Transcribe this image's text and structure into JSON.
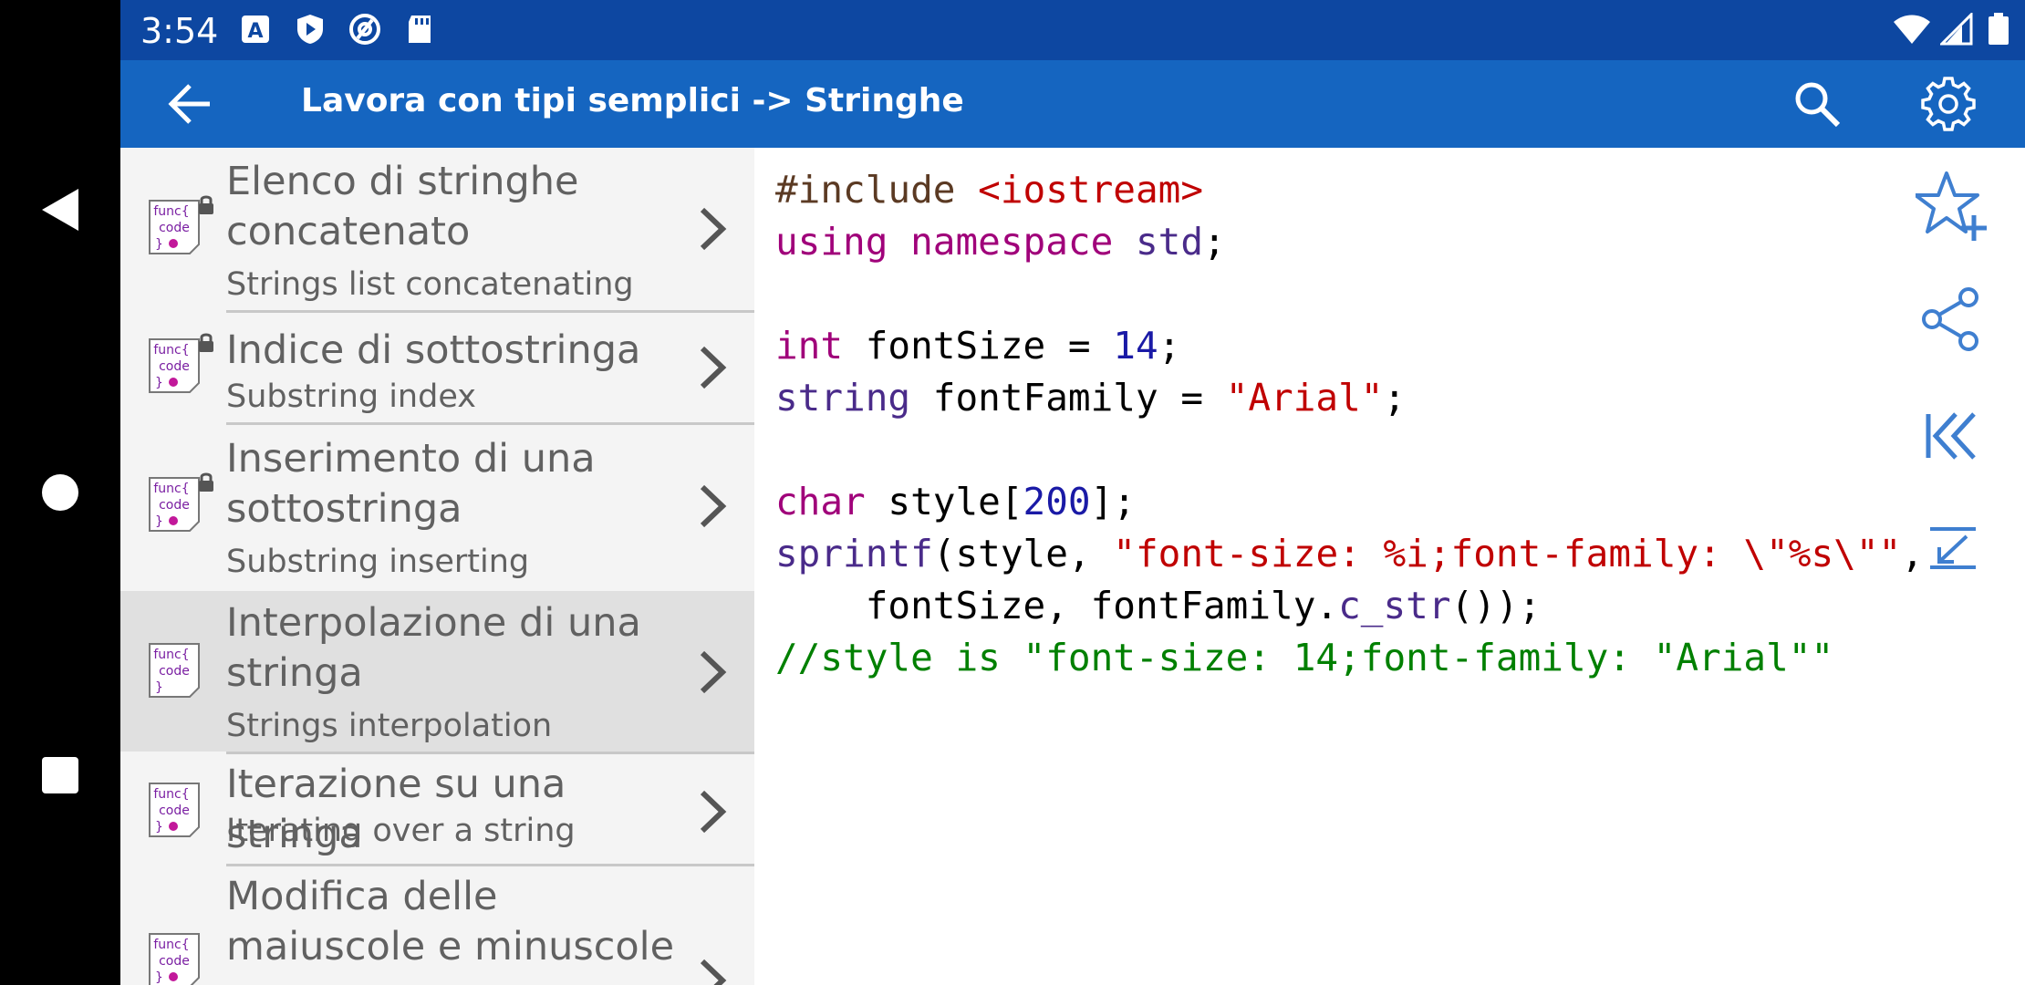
{
  "status_bar": {
    "time": "3:54"
  },
  "app_bar": {
    "title": "Lavora con tipi semplici -> Stringhe"
  },
  "list": {
    "items": [
      {
        "title_line1": "Elenco di stringhe",
        "title_line2": "concatenato",
        "subtitle": "Strings list concatenating",
        "locked": true,
        "icon_text": [
          "func{",
          "code",
          "}"
        ]
      },
      {
        "title_line1": "Indice di sottostringa",
        "subtitle": "Substring index",
        "locked": true,
        "icon_text": [
          "func{",
          "code",
          "}"
        ]
      },
      {
        "title_line1": "Inserimento di una",
        "title_line2": "sottostringa",
        "subtitle": "Substring inserting",
        "locked": true,
        "icon_text": [
          "func{",
          "code",
          "}"
        ]
      },
      {
        "title_line1": "Interpolazione di una",
        "title_line2": "stringa",
        "subtitle": "Strings interpolation",
        "locked": false,
        "selected": true,
        "icon_text": [
          "func{",
          "code",
          "}"
        ]
      },
      {
        "title_line1": "Iterazione su una stringa",
        "subtitle": "Iterating over a string",
        "locked": false,
        "icon_text": [
          "func{",
          "code",
          "}"
        ]
      },
      {
        "title_line1": "Modifica delle",
        "title_line2": "maiuscole e minuscole",
        "locked": false,
        "icon_text": [
          "func{",
          "code",
          "}"
        ]
      }
    ]
  },
  "code": {
    "l1_pp": "#include ",
    "l1_inc": "<iostream>",
    "l2_kw": "using namespace",
    "l2_ns": "std",
    "l2_end": ";",
    "l4_kw": "int",
    "l4_mid": " fontSize = ",
    "l4_num": "14",
    "l4_end": ";",
    "l5_ty": "string",
    "l5_mid": " fontFamily = ",
    "l5_str": "\"Arial\"",
    "l5_end": ";",
    "l7_kw": "char",
    "l7_mid": " style[",
    "l7_num": "200",
    "l7_end": "];",
    "l8_fn": "sprintf",
    "l8_mid": "(style, ",
    "l8_str": "\"font-size: %i;font-family: \\\"%s\\\"\"",
    "l8_end": ",",
    "l9_mid": "    fontSize, fontFamily.",
    "l9_fn": "c_str",
    "l9_end": "());",
    "l10_cm": "//style is \"font-size: 14;font-family: \"Arial\"\""
  },
  "icons": {
    "nav": [
      "back-triangle",
      "home-circle",
      "recents-square"
    ],
    "status": [
      "a-notification",
      "shield-play",
      "at-sign",
      "sd-card",
      "wifi",
      "signal",
      "battery"
    ],
    "app_bar": [
      "back-arrow",
      "search",
      "settings-gear"
    ],
    "side_actions": [
      "star-add",
      "share",
      "first-page",
      "collapse"
    ]
  },
  "colors": {
    "status_bar": "#0d47a1",
    "app_bar": "#1565c0",
    "accent_icon": "#3f7fd0",
    "selected_row": "#e0e0e0"
  }
}
